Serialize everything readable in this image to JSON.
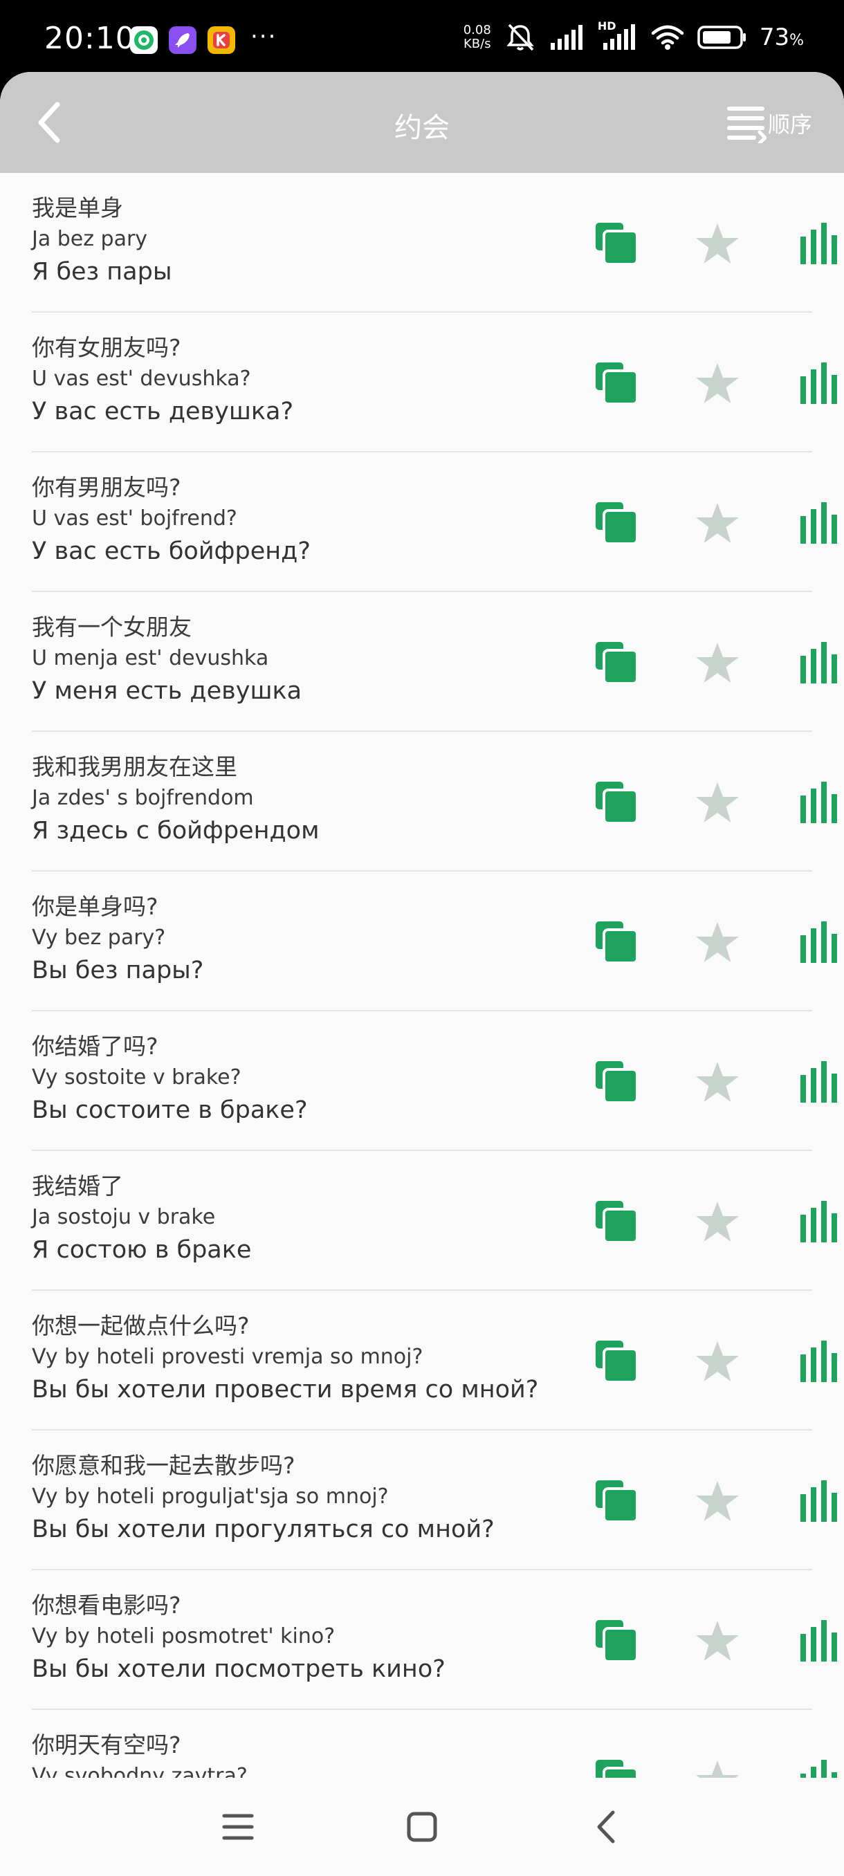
{
  "status_bar": {
    "time": "20:10",
    "netspeed_value": "0.08",
    "netspeed_unit": "KB/s",
    "signal_tag": "HD",
    "battery_percent": "73",
    "battery_unit": "%",
    "more": "···",
    "app_icons": [
      {
        "name": "green-app-icon",
        "color": "#1fb86b"
      },
      {
        "name": "rocket-app-icon",
        "color": "#8a4ff0"
      },
      {
        "name": "k-app-icon",
        "color": "#f5b800"
      }
    ]
  },
  "header": {
    "title": "约会",
    "order_label": "顺序",
    "background": "#c9c9c9"
  },
  "accent_color": "#1fa35c",
  "star_color": "#c9d3cd",
  "phrases": [
    {
      "zh": "我是单身",
      "translit": "Ja bez pary",
      "ru": "Я без пары"
    },
    {
      "zh": "你有女朋友吗?",
      "translit": "U vas est' devushka?",
      "ru": "У вас есть девушка?"
    },
    {
      "zh": "你有男朋友吗?",
      "translit": "U vas est' bojfrend?",
      "ru": "У вас есть бойфренд?"
    },
    {
      "zh": "我有一个女朋友",
      "translit": "U menja est' devushka",
      "ru": "У меня есть девушка"
    },
    {
      "zh": "我和我男朋友在这里",
      "translit": "Ja zdes' s bojfrendom",
      "ru": "Я здесь с бойфрендом"
    },
    {
      "zh": "你是单身吗?",
      "translit": "Vy bez pary?",
      "ru": "Вы без пары?"
    },
    {
      "zh": "你结婚了吗?",
      "translit": "Vy sostoite v brake?",
      "ru": "Вы состоите в браке?"
    },
    {
      "zh": "我结婚了",
      "translit": "Ja sostoju v brake",
      "ru": "Я состою в браке"
    },
    {
      "zh": "你想一起做点什么吗?",
      "translit": "Vy by hoteli provesti vremja so mnoj?",
      "ru": "Вы бы хотели провести время со мной?"
    },
    {
      "zh": "你愿意和我一起去散步吗?",
      "translit": "Vy by hoteli proguljat'sja so mnoj?",
      "ru": "Вы бы хотели прогуляться со мной?"
    },
    {
      "zh": "你想看电影吗?",
      "translit": "Vy by hoteli posmotret' kino?",
      "ru": "Вы бы хотели посмотреть кино?"
    },
    {
      "zh": "你明天有空吗?",
      "translit": "Vy svobodny zavtra?",
      "ru": ""
    }
  ]
}
